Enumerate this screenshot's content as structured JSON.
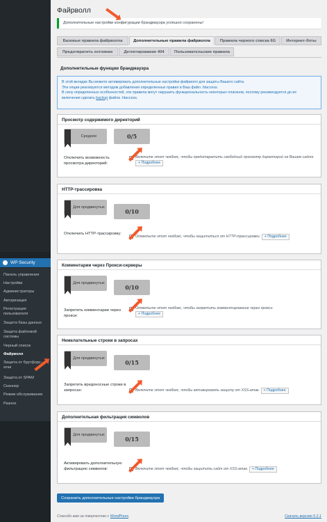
{
  "sidebar": {
    "plugin_title": "WP Security",
    "items": [
      {
        "label": "Панель управления"
      },
      {
        "label": "Настройки"
      },
      {
        "label": "Администраторы"
      },
      {
        "label": "Авторизация"
      },
      {
        "label": "Регистрация пользователя"
      },
      {
        "label": "Защита базы данных"
      },
      {
        "label": "Защита файловой системы"
      },
      {
        "label": "Черный список"
      },
      {
        "label": "Файрволл"
      },
      {
        "label": "Защита от брутфорс-атак"
      },
      {
        "label": "Защита от SPAM"
      },
      {
        "label": "Сканнер"
      },
      {
        "label": "Режим обслуживания"
      },
      {
        "label": "Разное"
      }
    ]
  },
  "page": {
    "title": "Файрволл",
    "notice": "Дополнительные настройки конфигурации брандмауэра успешно сохранены!"
  },
  "tabs": [
    {
      "label": "Базовые правила файрволла"
    },
    {
      "label": "Дополнительные правила файрволла"
    },
    {
      "label": "Правила черного списка 6G"
    },
    {
      "label": "Интернет-боты"
    },
    {
      "label": "Предотвратить хотлинки"
    },
    {
      "label": "Детектирование 404"
    },
    {
      "label": "Пользовательские правила"
    }
  ],
  "section_title": "Дополнительные функции брандмауэра",
  "info": {
    "line1": "В этой вкладке Вы можете активировать дополнительные настройки файрволл для защиты Вашего сайта.",
    "line2": "Эти опции реализуются методом добавления определенных правил в Ваш файл .htaccess.",
    "line3": "В силу определенных особенностей, эти правила могут нарушить функциональность некоторых плагинов, поэтому рекомендуется до их",
    "line4_pre": "включения сделать ",
    "line4_link": "backup",
    "line4_post": " файла .htaccess."
  },
  "boxes": [
    {
      "title": "Просмотр содержимого директорий",
      "badge": "Среднее",
      "score": "0/5",
      "label": "Отключить возможность просмотра директорий:",
      "desc": "Включите этот чекбокс, чтобы предотвратить свободный просмотр директорий на Вашем сайте",
      "more": "+ Подробнее",
      "checked": true
    },
    {
      "title": "HTTP-трассировка",
      "badge": "Для продвинутых",
      "score": "0/10",
      "label": "Отключить HTTP-трассировку:",
      "desc": "Отметьте этот чекбокс, чтобы защититься от HTTP-трассировки.",
      "more": "+ Подробнее",
      "checked": true
    },
    {
      "title": "Комментарии через Прокси-серверы",
      "badge": "Для продвинутых",
      "score": "0/10",
      "label": "Запретить комментарии через прокси:",
      "desc": "Отметьте этот чекбокс, чтобы запретить комментирование через прокси.",
      "more": "+ Подробнее",
      "checked": true
    },
    {
      "title": "Нежелательные строки в запросах",
      "badge": "Для продвинутых",
      "score": "0/15",
      "label": "Запретить вредоносные строки в запросах:",
      "desc": "Включите этот чекбокс, чтобы активировать защиту от XSS-атак.",
      "more": "+ Подробнее",
      "checked": true
    },
    {
      "title": "Дополнительная фильтрация символов",
      "badge": "Для продвинутых",
      "score": "0/15",
      "label": "Активировать дополнительную фильтрацию символов:",
      "desc": "Включите этот чекбокс, чтобы защитить сайт от XSS-атак.",
      "more": "+ Подробнее",
      "checked": true
    }
  ],
  "save_button": "Сохранить дополнительные настройки брандмауэра",
  "footer": {
    "left_pre": "Спасибо вам за творчество с ",
    "left_link": "WordPress",
    "left_post": ".",
    "right": "Скачать версию 5.2.1"
  },
  "colors": {
    "accent": "#2271b1",
    "arrow": "#f25a2c",
    "success": "#00a32a"
  }
}
